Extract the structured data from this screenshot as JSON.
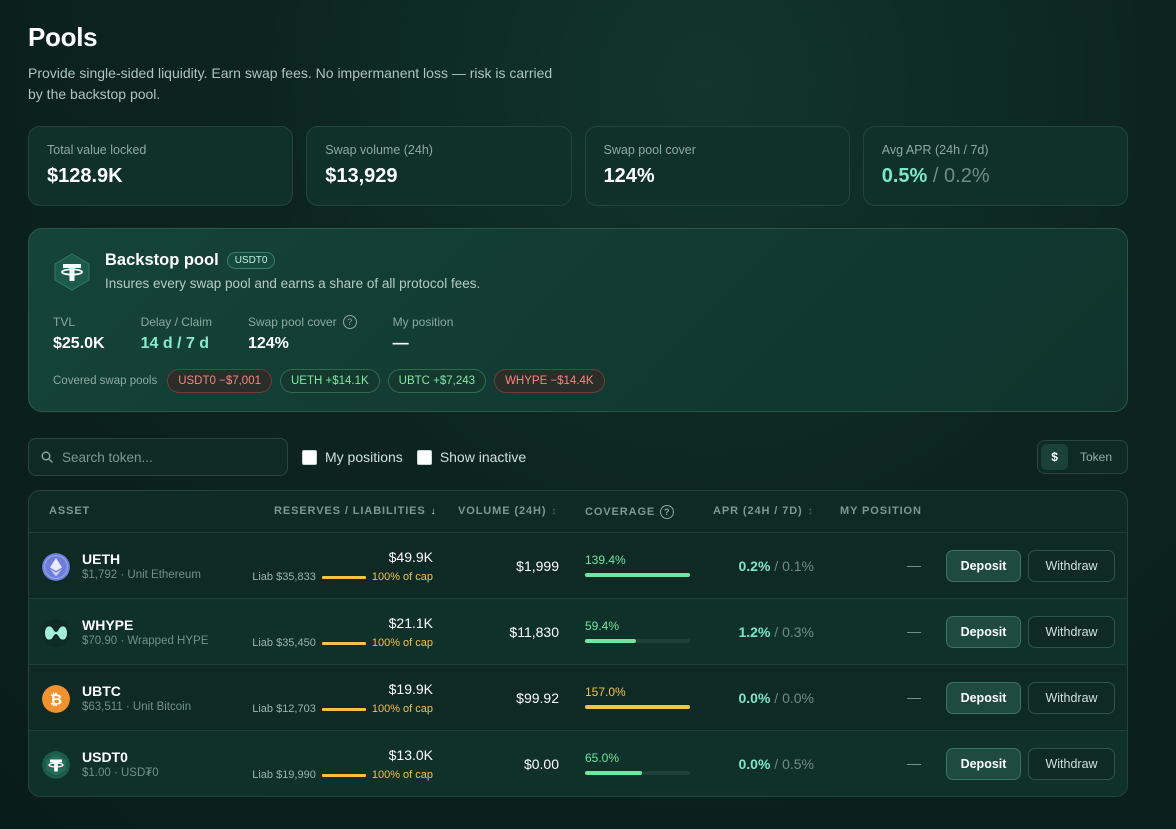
{
  "header": {
    "title": "Pools",
    "subtitle": "Provide single-sided liquidity. Earn swap fees. No impermanent loss — risk is carried by the backstop pool."
  },
  "stats": [
    {
      "label": "Total value locked",
      "value": "$128.9K"
    },
    {
      "label": "Swap volume (24h)",
      "value": "$13,929"
    },
    {
      "label": "Swap pool cover",
      "value": "124%"
    },
    {
      "label": "Avg APR (24h / 7d)",
      "value_24h": "0.5%",
      "separator": "/",
      "value_7d": "0.2%"
    }
  ],
  "backstop": {
    "title": "Backstop pool",
    "badge": "USDT0",
    "description": "Insures every swap pool and earns a share of all protocol fees.",
    "metrics": [
      {
        "label": "TVL",
        "value": "$25.0K"
      },
      {
        "label": "Delay / Claim",
        "value": "14 d / 7 d"
      },
      {
        "label": "Swap pool cover",
        "value": "124%"
      },
      {
        "label": "My position",
        "value": "—"
      }
    ],
    "covered_label": "Covered swap pools",
    "covered": [
      {
        "label": "USDT0 −$7,001",
        "tone": "negative"
      },
      {
        "label": "UETH +$14.1K",
        "tone": "positive"
      },
      {
        "label": "UBTC +$7,243",
        "tone": "positive"
      },
      {
        "label": "WHYPE −$14.4K",
        "tone": "negative"
      }
    ]
  },
  "toolbar": {
    "search_placeholder": "Search token...",
    "my_positions_label": "My positions",
    "show_inactive_label": "Show inactive",
    "unit_options": [
      "$",
      "Token"
    ],
    "unit_selected": "$"
  },
  "table": {
    "columns": {
      "asset": "ASSET",
      "reserves": "RESERVES / LIABILITIES",
      "volume": "VOLUME (24H)",
      "coverage": "COVERAGE",
      "apr": "APR (24H / 7D)",
      "position": "MY POSITION"
    },
    "sort_indicator": "↓",
    "sort_idle": "↕",
    "help_glyph": "?",
    "rows": [
      {
        "symbol": "UETH",
        "sub": "$1,792 · Unit Ethereum",
        "reserve": "$49.9K",
        "liab": "Liab $35,833",
        "cap": "100% of cap",
        "cap_fraction": 1.0,
        "volume": "$1,999",
        "coverage": "139.4%",
        "coverage_fraction": 1.0,
        "coverage_color": "green",
        "apr_24h": "0.2%",
        "apr_sep": " / ",
        "apr_7d": "0.1%",
        "position": "—",
        "deposit": "Deposit",
        "withdraw": "Withdraw",
        "icon": "ethereum-icon"
      },
      {
        "symbol": "WHYPE",
        "sub": "$70.90 · Wrapped HYPE",
        "reserve": "$21.1K",
        "liab": "Liab $35,450",
        "cap": "100% of cap",
        "cap_fraction": 1.0,
        "volume": "$11,830",
        "coverage": "59.4%",
        "coverage_fraction": 0.49,
        "coverage_color": "green",
        "apr_24h": "1.2%",
        "apr_sep": " / ",
        "apr_7d": "0.3%",
        "position": "—",
        "deposit": "Deposit",
        "withdraw": "Withdraw",
        "icon": "hype-icon"
      },
      {
        "symbol": "UBTC",
        "sub": "$63,511 · Unit Bitcoin",
        "reserve": "$19.9K",
        "liab": "Liab $12,703",
        "cap": "100% of cap",
        "cap_fraction": 1.0,
        "volume": "$99.92",
        "coverage": "157.0%",
        "coverage_fraction": 1.0,
        "coverage_color": "yellow",
        "apr_24h": "0.0%",
        "apr_sep": " / ",
        "apr_7d": "0.0%",
        "position": "—",
        "deposit": "Deposit",
        "withdraw": "Withdraw",
        "icon": "bitcoin-icon"
      },
      {
        "symbol": "USDT0",
        "sub": "$1.00 · USD₮0",
        "reserve": "$13.0K",
        "liab": "Liab $19,990",
        "cap": "100% of cap",
        "cap_fraction": 1.0,
        "volume": "$0.00",
        "coverage": "65.0%",
        "coverage_fraction": 0.54,
        "coverage_color": "green",
        "apr_24h": "0.0%",
        "apr_sep": " / ",
        "apr_7d": "0.5%",
        "position": "—",
        "deposit": "Deposit",
        "withdraw": "Withdraw",
        "icon": "tether-icon"
      }
    ]
  },
  "colors": {
    "accent": "#7ee8c6",
    "positive": "#6ee7a0",
    "warning": "#f2c14e",
    "negative": "#f0897f"
  }
}
